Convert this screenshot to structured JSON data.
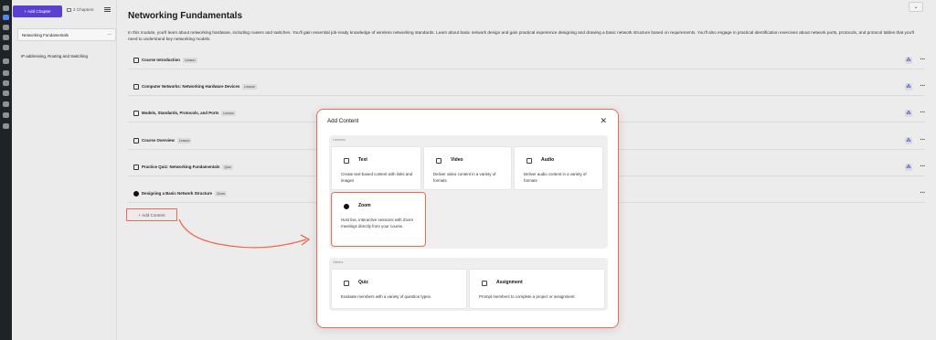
{
  "sidebar": {
    "add_chapter_label": "+ Add Chapter",
    "chapters_count": "2 Chapters",
    "chapters": [
      {
        "title": "Networking Fundamentals",
        "more": "···"
      },
      {
        "title": "IP addressing, Routing and Switching"
      }
    ]
  },
  "main": {
    "title": "Networking Fundamentals",
    "collapse_chevron": "⌄",
    "description": "In this module, you'll learn about networking hardware, including routers and switches. You'll gain essential job-ready knowledge of wireless networking standards. Learn about basic network design and gain practical experience designing and drawing a basic network structure based on requirements. You'll also engage in practical identification exercises about network ports, protocols, and protocol tables that you'll need to understand key networking models.",
    "lessons": [
      {
        "title": "Course Introduction",
        "tag": "Lesson",
        "icon": "lesson-icon"
      },
      {
        "title": "Computer Networks: Networking Hardware Devices",
        "tag": "Lesson",
        "icon": "lesson-icon"
      },
      {
        "title": "Models, Standards, Protocols, and Ports",
        "tag": "Lesson",
        "icon": "lesson-icon"
      },
      {
        "title": "Course Overview",
        "tag": "Lesson",
        "icon": "lesson-icon"
      },
      {
        "title": "Practice Quiz: Networking Fundamentals",
        "tag": "Quiz",
        "icon": "quiz-icon"
      },
      {
        "title": "Designing a Basic Network Structure",
        "tag": "Zoom",
        "icon": "zoom-icon"
      }
    ],
    "row_more": "···",
    "row_action_glyph": "⁂",
    "add_content_label": "+ Add Content"
  },
  "modal": {
    "title": "Add Content",
    "close": "✕",
    "lessons_section": {
      "label": "Lessons",
      "cards": [
        {
          "title": "Text",
          "desc": "Create text-based content with links and images",
          "icon": "text-icon"
        },
        {
          "title": "Video",
          "desc": "Deliver video content in a variety of formats",
          "icon": "video-icon"
        },
        {
          "title": "Audio",
          "desc": "Deliver audio content in a variety of formats",
          "icon": "audio-icon"
        },
        {
          "title": "Zoom",
          "desc": "Host live, interactive sessions with Zoom meetings directly from your course.",
          "icon": "zoom-icon"
        }
      ]
    },
    "others_section": {
      "label": "Others",
      "cards": [
        {
          "title": "Quiz",
          "desc": "Evaluate members with a variety of question types.",
          "icon": "quiz-icon"
        },
        {
          "title": "Assignment",
          "desc": "Prompt members to complete a project or assignment.",
          "icon": "assignment-icon"
        }
      ]
    }
  },
  "colors": {
    "accent": "#5a3fd1",
    "highlight": "#ef6a4f",
    "rail": "#1f2326"
  }
}
